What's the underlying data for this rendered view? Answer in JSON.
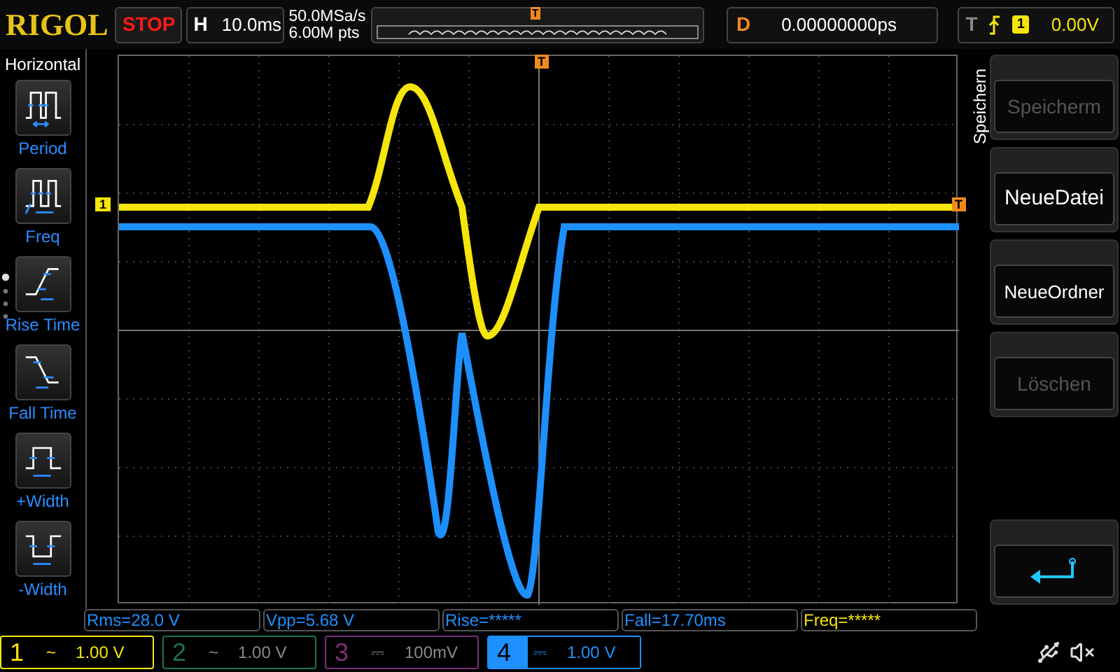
{
  "brand": "RIGOL",
  "run_state": "STOP",
  "horizontal": {
    "label": "H",
    "value": "10.0ms"
  },
  "sample": {
    "rate": "50.0MSa/s",
    "depth": "6.00M pts"
  },
  "memory_trigger_marker": "T",
  "delay": {
    "label": "D",
    "value": "0.00000000ps"
  },
  "trigger": {
    "label": "T",
    "source": "1",
    "level": "0.00V"
  },
  "left_menu": {
    "title": "Horizontal",
    "items": [
      {
        "label": "Period",
        "kind": "period"
      },
      {
        "label": "Freq",
        "kind": "freq"
      },
      {
        "label": "Rise Time",
        "kind": "rise"
      },
      {
        "label": "Fall Time",
        "kind": "fall"
      },
      {
        "label": "+Width",
        "kind": "pwidth"
      },
      {
        "label": "-Width",
        "kind": "nwidth"
      }
    ]
  },
  "screen_markers": {
    "channel": "1",
    "trigger_top": "T",
    "trigger_level": "T"
  },
  "right_menu": {
    "title": "Speichern",
    "items": [
      {
        "label": "Speicherm",
        "disabled": true
      },
      {
        "label": "NeueDatei",
        "disabled": false
      },
      {
        "label": "NeueOrdner",
        "disabled": false
      },
      {
        "label": "Löschen",
        "disabled": true
      }
    ]
  },
  "measurements": [
    {
      "text": "Rms=28.0 V",
      "color": "#1e90ff"
    },
    {
      "text": "Vpp=5.68 V",
      "color": "#1e90ff"
    },
    {
      "text": "Rise=*****",
      "color": "#1e90ff"
    },
    {
      "text": "Fall=17.70ms",
      "color": "#1e90ff"
    },
    {
      "text": "Freq=*****",
      "color": "#f5e50a"
    }
  ],
  "channels": [
    {
      "number": "1",
      "coupling": "~",
      "scale": "1.00 V",
      "selected": false,
      "color": "#f5e50a"
    },
    {
      "number": "2",
      "coupling": "~",
      "scale": "1.00 V",
      "selected": false,
      "color": "#1f6f60"
    },
    {
      "number": "3",
      "coupling": "⎓",
      "scale": "100mV",
      "selected": false,
      "color": "#7a2f7a"
    },
    {
      "number": "4",
      "coupling": "⎓",
      "scale": "1.00 V",
      "selected": true,
      "color": "#1e90ff"
    }
  ]
}
